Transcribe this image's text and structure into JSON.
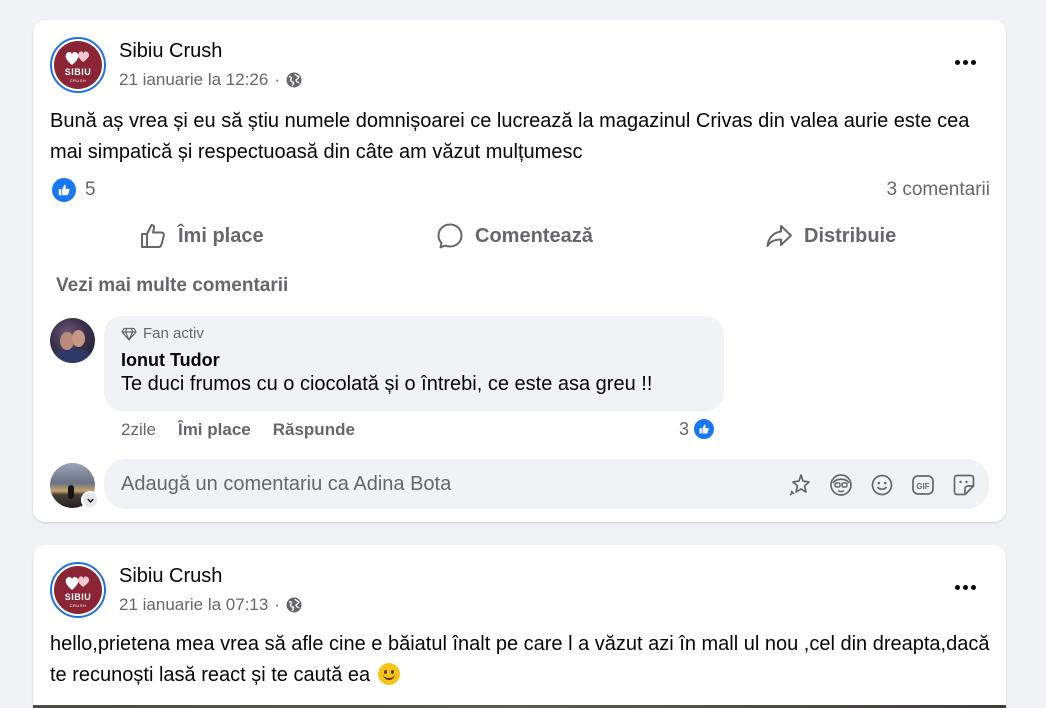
{
  "posts": [
    {
      "page_name": "Sibiu Crush",
      "date": "21 ianuarie la 12:26",
      "separator": "·",
      "text": "Bună aș vrea și eu să știu numele domnișoarei ce lucrează la magazinul Crivas din valea aurie este cea mai simpatică și respectuoasă din câte am văzut mulțumesc",
      "like_count": "5",
      "comment_count": "3 comentarii",
      "actions": {
        "like": "Îmi place",
        "comment": "Comentează",
        "share": "Distribuie"
      },
      "see_more": "Vezi mai multe comentarii",
      "comment": {
        "badge": "Fan activ",
        "author": "Ionut Tudor",
        "text": "Te duci frumos cu o ciocolată și o întrebi, ce este asa greu !!",
        "time": "2zile",
        "like": "Îmi place",
        "reply": "Răspunde",
        "reactions": "3"
      },
      "comment_input_placeholder": "Adaugă un comentariu ca Adina Bota"
    },
    {
      "page_name": "Sibiu Crush",
      "date": "21 ianuarie la 07:13",
      "separator": "·",
      "text": "hello,prietena mea vrea să afle cine e băiatul înalt pe care l a văzut azi în mall ul nou ,cel din dreapta,dacă te recunoști lasă react și te caută ea"
    }
  ],
  "logo": {
    "main": "SIBIU",
    "sub": "CRUSH"
  },
  "icons": {
    "globe": "globe-icon",
    "more": "more-options-icon",
    "like_reaction": "thumbs-up-icon",
    "like": "thumbs-up-outline-icon",
    "comment": "speech-bubble-icon",
    "share": "share-arrow-icon",
    "fan_badge": "diamond-icon",
    "avatar_sticker": "avatar-sticker-icon",
    "emoji": "smiley-icon",
    "gif": "gif-icon",
    "sticker": "sticker-icon",
    "effects": "sparkle-icon"
  },
  "colors": {
    "accent": "#1877f2",
    "secondary_text": "#65676b",
    "brand": "#8b2434"
  }
}
